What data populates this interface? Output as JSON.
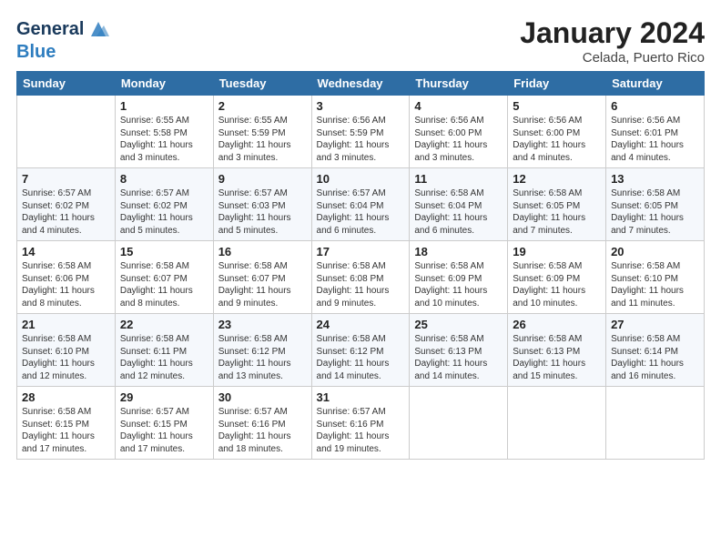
{
  "logo": {
    "line1": "General",
    "line2": "Blue"
  },
  "title": "January 2024",
  "location": "Celada, Puerto Rico",
  "weekdays": [
    "Sunday",
    "Monday",
    "Tuesday",
    "Wednesday",
    "Thursday",
    "Friday",
    "Saturday"
  ],
  "weeks": [
    [
      {
        "day": "",
        "info": ""
      },
      {
        "day": "1",
        "info": "Sunrise: 6:55 AM\nSunset: 5:58 PM\nDaylight: 11 hours\nand 3 minutes."
      },
      {
        "day": "2",
        "info": "Sunrise: 6:55 AM\nSunset: 5:59 PM\nDaylight: 11 hours\nand 3 minutes."
      },
      {
        "day": "3",
        "info": "Sunrise: 6:56 AM\nSunset: 5:59 PM\nDaylight: 11 hours\nand 3 minutes."
      },
      {
        "day": "4",
        "info": "Sunrise: 6:56 AM\nSunset: 6:00 PM\nDaylight: 11 hours\nand 3 minutes."
      },
      {
        "day": "5",
        "info": "Sunrise: 6:56 AM\nSunset: 6:00 PM\nDaylight: 11 hours\nand 4 minutes."
      },
      {
        "day": "6",
        "info": "Sunrise: 6:56 AM\nSunset: 6:01 PM\nDaylight: 11 hours\nand 4 minutes."
      }
    ],
    [
      {
        "day": "7",
        "info": "Sunrise: 6:57 AM\nSunset: 6:02 PM\nDaylight: 11 hours\nand 4 minutes."
      },
      {
        "day": "8",
        "info": "Sunrise: 6:57 AM\nSunset: 6:02 PM\nDaylight: 11 hours\nand 5 minutes."
      },
      {
        "day": "9",
        "info": "Sunrise: 6:57 AM\nSunset: 6:03 PM\nDaylight: 11 hours\nand 5 minutes."
      },
      {
        "day": "10",
        "info": "Sunrise: 6:57 AM\nSunset: 6:04 PM\nDaylight: 11 hours\nand 6 minutes."
      },
      {
        "day": "11",
        "info": "Sunrise: 6:58 AM\nSunset: 6:04 PM\nDaylight: 11 hours\nand 6 minutes."
      },
      {
        "day": "12",
        "info": "Sunrise: 6:58 AM\nSunset: 6:05 PM\nDaylight: 11 hours\nand 7 minutes."
      },
      {
        "day": "13",
        "info": "Sunrise: 6:58 AM\nSunset: 6:05 PM\nDaylight: 11 hours\nand 7 minutes."
      }
    ],
    [
      {
        "day": "14",
        "info": "Sunrise: 6:58 AM\nSunset: 6:06 PM\nDaylight: 11 hours\nand 8 minutes."
      },
      {
        "day": "15",
        "info": "Sunrise: 6:58 AM\nSunset: 6:07 PM\nDaylight: 11 hours\nand 8 minutes."
      },
      {
        "day": "16",
        "info": "Sunrise: 6:58 AM\nSunset: 6:07 PM\nDaylight: 11 hours\nand 9 minutes."
      },
      {
        "day": "17",
        "info": "Sunrise: 6:58 AM\nSunset: 6:08 PM\nDaylight: 11 hours\nand 9 minutes."
      },
      {
        "day": "18",
        "info": "Sunrise: 6:58 AM\nSunset: 6:09 PM\nDaylight: 11 hours\nand 10 minutes."
      },
      {
        "day": "19",
        "info": "Sunrise: 6:58 AM\nSunset: 6:09 PM\nDaylight: 11 hours\nand 10 minutes."
      },
      {
        "day": "20",
        "info": "Sunrise: 6:58 AM\nSunset: 6:10 PM\nDaylight: 11 hours\nand 11 minutes."
      }
    ],
    [
      {
        "day": "21",
        "info": "Sunrise: 6:58 AM\nSunset: 6:10 PM\nDaylight: 11 hours\nand 12 minutes."
      },
      {
        "day": "22",
        "info": "Sunrise: 6:58 AM\nSunset: 6:11 PM\nDaylight: 11 hours\nand 12 minutes."
      },
      {
        "day": "23",
        "info": "Sunrise: 6:58 AM\nSunset: 6:12 PM\nDaylight: 11 hours\nand 13 minutes."
      },
      {
        "day": "24",
        "info": "Sunrise: 6:58 AM\nSunset: 6:12 PM\nDaylight: 11 hours\nand 14 minutes."
      },
      {
        "day": "25",
        "info": "Sunrise: 6:58 AM\nSunset: 6:13 PM\nDaylight: 11 hours\nand 14 minutes."
      },
      {
        "day": "26",
        "info": "Sunrise: 6:58 AM\nSunset: 6:13 PM\nDaylight: 11 hours\nand 15 minutes."
      },
      {
        "day": "27",
        "info": "Sunrise: 6:58 AM\nSunset: 6:14 PM\nDaylight: 11 hours\nand 16 minutes."
      }
    ],
    [
      {
        "day": "28",
        "info": "Sunrise: 6:58 AM\nSunset: 6:15 PM\nDaylight: 11 hours\nand 17 minutes."
      },
      {
        "day": "29",
        "info": "Sunrise: 6:57 AM\nSunset: 6:15 PM\nDaylight: 11 hours\nand 17 minutes."
      },
      {
        "day": "30",
        "info": "Sunrise: 6:57 AM\nSunset: 6:16 PM\nDaylight: 11 hours\nand 18 minutes."
      },
      {
        "day": "31",
        "info": "Sunrise: 6:57 AM\nSunset: 6:16 PM\nDaylight: 11 hours\nand 19 minutes."
      },
      {
        "day": "",
        "info": ""
      },
      {
        "day": "",
        "info": ""
      },
      {
        "day": "",
        "info": ""
      }
    ]
  ]
}
